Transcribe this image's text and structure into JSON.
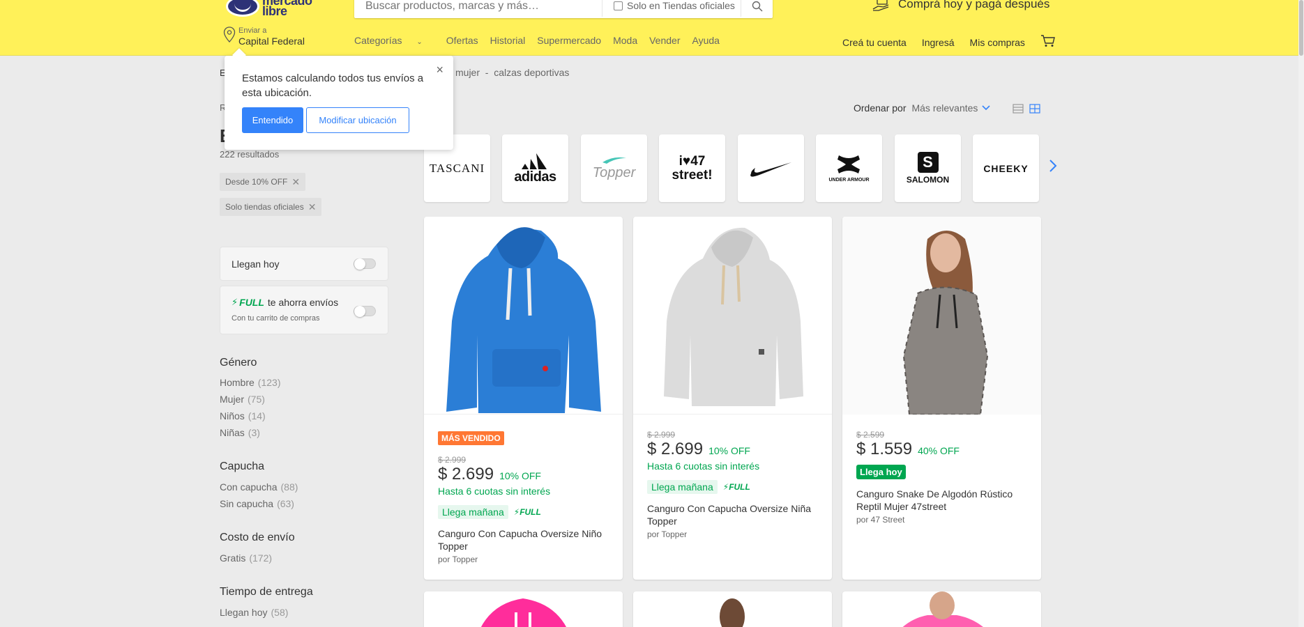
{
  "header": {
    "logo_text_1": "mercado",
    "logo_text_2": "libre",
    "search_placeholder": "Buscar productos, marcas y más…",
    "official_only": "Solo en Tiendas oficiales",
    "promo": "Comprá hoy y pagá después",
    "location_label": "Enviar a",
    "location_value": "Capital Federal",
    "nav": [
      "Categorías",
      "Ofertas",
      "Historial",
      "Supermercado",
      "Moda",
      "Vender",
      "Ayuda"
    ],
    "account": [
      "Creá tu cuenta",
      "Ingresá",
      "Mis compras"
    ]
  },
  "tooltip": {
    "message": "Estamos calculando todos tus envíos a esta ubicación.",
    "primary": "Entendido",
    "secondary": "Modificar ubicación",
    "close": "×"
  },
  "breadcrumb": {
    "left_fragment": "E",
    "trail": "mujer  -  calzas deportivas"
  },
  "sidebar": {
    "r_fragment": "R",
    "title_fragment": "B",
    "results": "222 resultados",
    "chips": [
      "Desde 10% OFF",
      "Solo tiendas oficiales"
    ],
    "toggle_today": "Llegan hoy",
    "full_label": "FULL",
    "full_text": "te ahorra envíos",
    "full_sub": "Con tu carrito de compras",
    "groups": [
      {
        "title": "Género",
        "items": [
          {
            "label": "Hombre",
            "count": "(123)"
          },
          {
            "label": "Mujer",
            "count": "(75)"
          },
          {
            "label": "Niños",
            "count": "(14)"
          },
          {
            "label": "Niñas",
            "count": "(3)"
          }
        ]
      },
      {
        "title": "Capucha",
        "items": [
          {
            "label": "Con capucha",
            "count": "(88)"
          },
          {
            "label": "Sin capucha",
            "count": "(63)"
          }
        ]
      },
      {
        "title": "Costo de envío",
        "items": [
          {
            "label": "Gratis",
            "count": "(172)"
          }
        ]
      },
      {
        "title": "Tiempo de entrega",
        "items": [
          {
            "label": "Llegan hoy",
            "count": "(58)"
          }
        ]
      }
    ]
  },
  "sort": {
    "label": "Ordenar por",
    "value": "Más relevantes"
  },
  "brands": [
    "TASCANI",
    "adidas",
    "Topper",
    "i♥47 street!",
    "Nike",
    "UNDER ARMOUR",
    "SALOMON",
    "CHEEKY"
  ],
  "products": [
    {
      "badge": "MÁS VENDIDO",
      "old_price": "$ 2.999",
      "price": "$ 2.699",
      "off": "10% OFF",
      "installments": "Hasta 6 cuotas sin interés",
      "shipping": "Llega mañana",
      "full": "FULL",
      "title": "Canguro Con Capucha Oversize Niño Topper",
      "seller": "por Topper",
      "color": "#2b7ed6"
    },
    {
      "old_price": "$ 2.999",
      "price": "$ 2.699",
      "off": "10% OFF",
      "installments": "Hasta 6 cuotas sin interés",
      "shipping": "Llega mañana",
      "full": "FULL",
      "title": "Canguro Con Capucha Oversize Niña Topper",
      "seller": "por Topper",
      "color": "#dcdcdc"
    },
    {
      "old_price": "$ 2.599",
      "price": "$ 1.559",
      "off": "40% OFF",
      "arrival": "Llega hoy",
      "title": "Canguro Snake De Algodón Rústico Reptil Mujer 47street",
      "seller": "por 47 Street",
      "color": "#8a8581"
    }
  ],
  "colors": {
    "yellow": "#fff159",
    "blue": "#3483fa",
    "green": "#00a650",
    "orange": "#ff7733"
  }
}
